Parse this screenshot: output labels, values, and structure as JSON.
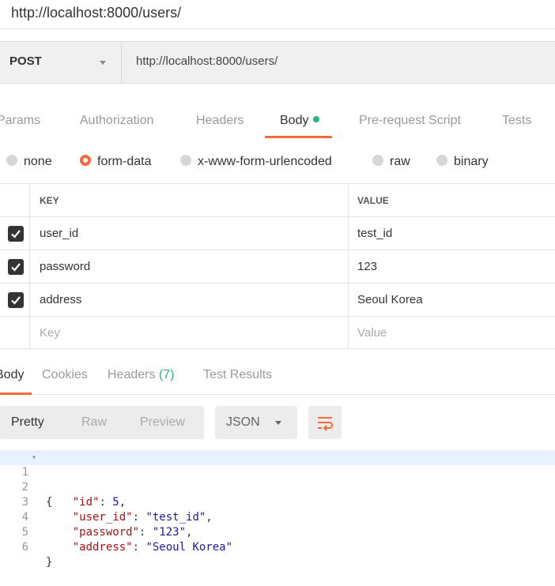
{
  "page_heading": "http://localhost:8000/users/",
  "request": {
    "method": "POST",
    "url": "http://localhost:8000/users/"
  },
  "request_tabs": [
    {
      "label": "Params"
    },
    {
      "label": "Authorization"
    },
    {
      "label": "Headers"
    },
    {
      "label": "Body",
      "active": true
    },
    {
      "label": "Pre-request Script"
    },
    {
      "label": "Tests"
    }
  ],
  "body_types": [
    {
      "label": "none"
    },
    {
      "label": "form-data",
      "selected": true
    },
    {
      "label": "x-www-form-urlencoded"
    },
    {
      "label": "raw"
    },
    {
      "label": "binary"
    }
  ],
  "form_table": {
    "headers": {
      "key": "KEY",
      "value": "VALUE"
    },
    "rows": [
      {
        "key": "user_id",
        "value": "test_id",
        "checked": true
      },
      {
        "key": "password",
        "value": "123",
        "checked": true
      },
      {
        "key": "address",
        "value": "Seoul Korea",
        "checked": true
      }
    ],
    "placeholder": {
      "key": "Key",
      "value": "Value"
    }
  },
  "response_tabs": [
    {
      "label": "Body",
      "active": true
    },
    {
      "label": "Cookies"
    },
    {
      "label": "Headers",
      "count": "(7)"
    },
    {
      "label": "Test Results"
    }
  ],
  "view_modes": [
    "Pretty",
    "Raw",
    "Preview"
  ],
  "active_view": "Pretty",
  "format": "JSON",
  "response_body": {
    "line_numbers": [
      "1",
      "2",
      "3",
      "4",
      "5",
      "6"
    ],
    "open_brace": "{",
    "close_brace": "}",
    "fields": [
      {
        "key": "\"id\"",
        "value": "5",
        "type": "number",
        "comma": ","
      },
      {
        "key": "\"user_id\"",
        "value": "\"test_id\"",
        "type": "string",
        "comma": ","
      },
      {
        "key": "\"password\"",
        "value": "\"123\"",
        "type": "string",
        "comma": ","
      },
      {
        "key": "\"address\"",
        "value": "\"Seoul Korea\"",
        "type": "string",
        "comma": ""
      }
    ]
  },
  "colors": {
    "accent": "#f26b3a",
    "success": "#26b47f",
    "json_key": "#a31515",
    "json_value": "#1a1aa6"
  },
  "icons": [
    "chevron-down-icon",
    "checkbox-checked-icon",
    "wrap-lines-icon",
    "fold-arrow-icon"
  ]
}
